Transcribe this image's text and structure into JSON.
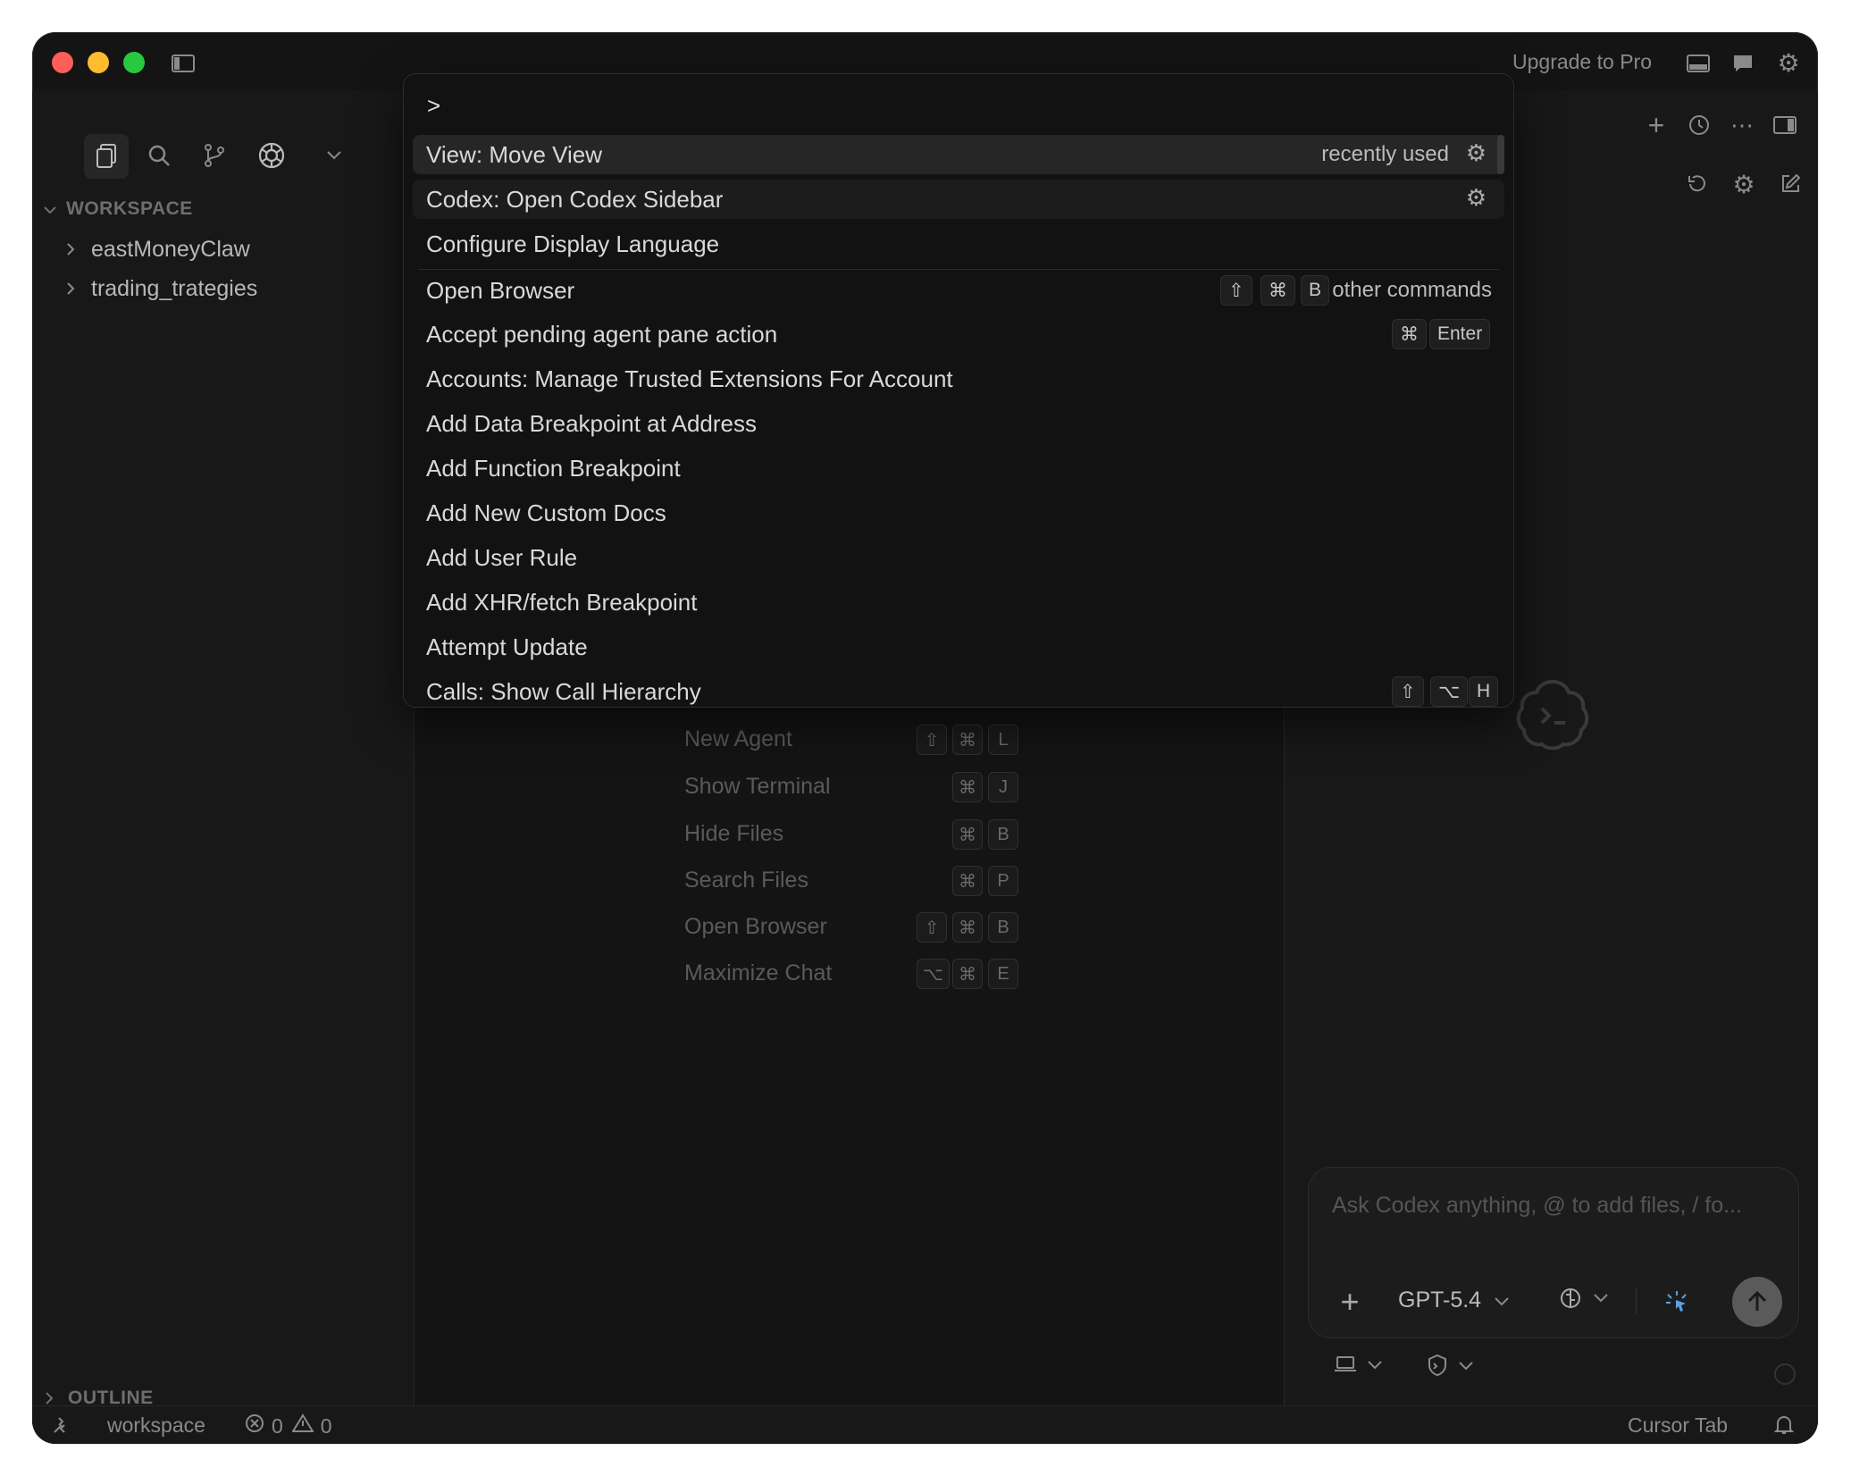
{
  "titlebar": {
    "upgrade_label": "Upgrade to Pro"
  },
  "sidebar": {
    "workspace_header": "WORKSPACE",
    "folders": [
      {
        "label": "eastMoneyClaw"
      },
      {
        "label": "trading_trategies"
      }
    ],
    "outline_header": "OUTLINE"
  },
  "palette": {
    "query": ">",
    "recently_used": "recently used",
    "other_commands": "other commands",
    "commands": [
      {
        "label": "View: Move View"
      },
      {
        "label": "Codex: Open Codex Sidebar"
      },
      {
        "label": "Configure Display Language"
      },
      {
        "label": "Open Browser",
        "keys": [
          "⇧",
          "⌘",
          "B"
        ]
      },
      {
        "label": "Accept pending agent pane action",
        "keys": [
          "⌘",
          "Enter"
        ]
      },
      {
        "label": "Accounts: Manage Trusted Extensions For Account"
      },
      {
        "label": "Add Data Breakpoint at Address"
      },
      {
        "label": "Add Function Breakpoint"
      },
      {
        "label": "Add New Custom Docs"
      },
      {
        "label": "Add User Rule"
      },
      {
        "label": "Add XHR/fetch Breakpoint"
      },
      {
        "label": "Attempt Update"
      },
      {
        "label": "Calls: Show Call Hierarchy",
        "keys": [
          "⇧",
          "⌥",
          "H"
        ]
      }
    ]
  },
  "editor_hints": [
    {
      "label": "New Agent",
      "keys": [
        "⇧",
        "⌘",
        "L"
      ]
    },
    {
      "label": "Show Terminal",
      "keys": [
        "⌘",
        "J"
      ]
    },
    {
      "label": "Hide Files",
      "keys": [
        "⌘",
        "B"
      ]
    },
    {
      "label": "Search Files",
      "keys": [
        "⌘",
        "P"
      ]
    },
    {
      "label": "Open Browser",
      "keys": [
        "⇧",
        "⌘",
        "B"
      ]
    },
    {
      "label": "Maximize Chat",
      "keys": [
        "⌥",
        "⌘",
        "E"
      ]
    }
  ],
  "composer": {
    "placeholder": "Ask Codex anything, @ to add files, / fo...",
    "model": "GPT-5.4"
  },
  "statusbar": {
    "workspace": "workspace",
    "errors": "0",
    "warnings": "0",
    "cursor_tab": "Cursor Tab"
  },
  "colors": {
    "close": "#ff5f57",
    "minimize": "#febc2e",
    "zoom": "#28c840",
    "background": "#141414",
    "palette_bg": "#121212",
    "selected_row": "#262626"
  }
}
